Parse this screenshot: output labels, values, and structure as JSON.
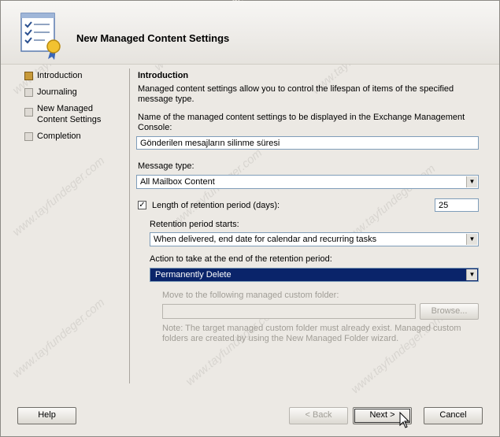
{
  "title": "New Managed Content Settings",
  "steps": [
    {
      "label": "Introduction",
      "active": true
    },
    {
      "label": "Journaling",
      "active": false
    },
    {
      "label": "New Managed Content Settings",
      "active": false
    },
    {
      "label": "Completion",
      "active": false
    }
  ],
  "intro": {
    "heading": "Introduction",
    "description": "Managed content settings allow you to control the lifespan of items of the specified message type.",
    "name_label": "Name of the managed content settings to be displayed in the Exchange Management Console:",
    "name_value": "Gönderilen mesajların silinme süresi"
  },
  "message_type": {
    "label": "Message type:",
    "value": "All Mailbox Content"
  },
  "retention": {
    "checkbox_label": "Length of retention period (days):",
    "checked": true,
    "days": "25",
    "starts_label": "Retention period starts:",
    "starts_value": "When delivered, end date for calendar and recurring tasks",
    "action_label": "Action to take at the end of the retention period:",
    "action_value": "Permanently Delete"
  },
  "move": {
    "label": "Move to the following managed custom folder:",
    "value": "",
    "browse": "Browse...",
    "note": "Note: The target managed custom folder must already exist. Managed custom folders are created by using the New Managed Folder wizard."
  },
  "buttons": {
    "help": "Help",
    "back": "< Back",
    "next": "Next >",
    "cancel": "Cancel"
  },
  "watermark": "www.tayfundeger.com"
}
